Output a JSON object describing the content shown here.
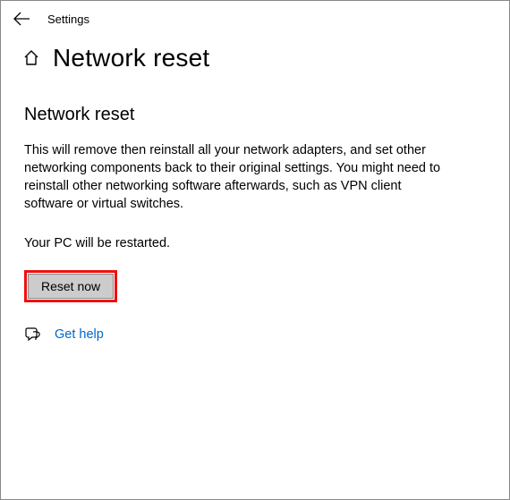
{
  "header": {
    "app_title": "Settings"
  },
  "page": {
    "title": "Network reset"
  },
  "content": {
    "section_heading": "Network reset",
    "description": "This will remove then reinstall all your network adapters, and set other networking components back to their original settings. You might need to reinstall other networking software afterwards, such as VPN client software or virtual switches.",
    "notice": "Your PC will be restarted.",
    "reset_button_label": "Reset now"
  },
  "help": {
    "link_label": "Get help"
  }
}
